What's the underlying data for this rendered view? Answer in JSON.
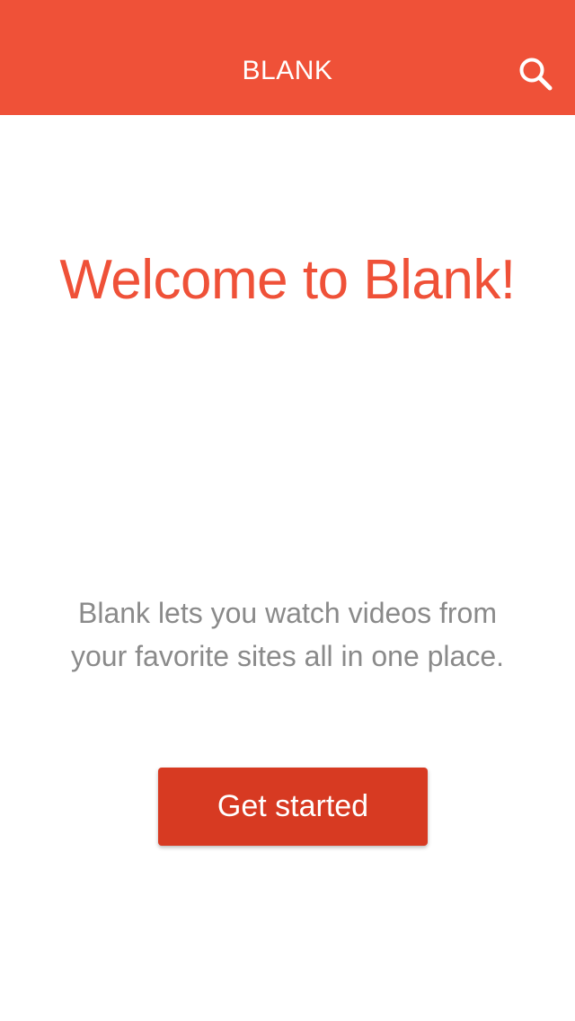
{
  "app_bar": {
    "title": "BLANK",
    "search_icon": "search-icon",
    "background_color": "#ef5138"
  },
  "welcome": {
    "heading": "Welcome to Blank!"
  },
  "description": {
    "line1": "Blank lets you watch videos from",
    "line2": "your favorite sites all in one place."
  },
  "cta": {
    "label": "Get started",
    "background_color": "#d73a22"
  }
}
